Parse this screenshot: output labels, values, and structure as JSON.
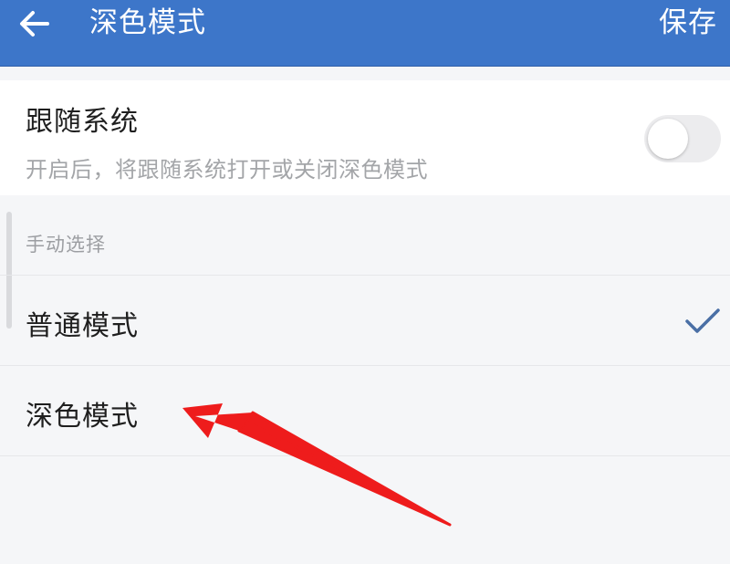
{
  "header": {
    "title": "深色模式",
    "save_label": "保存",
    "back_icon": "back-arrow-icon",
    "background_color": "#3d76c9"
  },
  "follow_system": {
    "title": "跟随系统",
    "description": "开启后，将跟随系统打开或关闭深色模式",
    "toggle_on": false
  },
  "manual": {
    "section_title": "手动选择",
    "options": [
      {
        "label": "普通模式",
        "selected": true
      },
      {
        "label": "深色模式",
        "selected": false
      }
    ],
    "check_icon": "checkmark-icon",
    "check_color": "#4a6fa5"
  },
  "annotation": {
    "arrow_color": "#ee1c1c"
  }
}
